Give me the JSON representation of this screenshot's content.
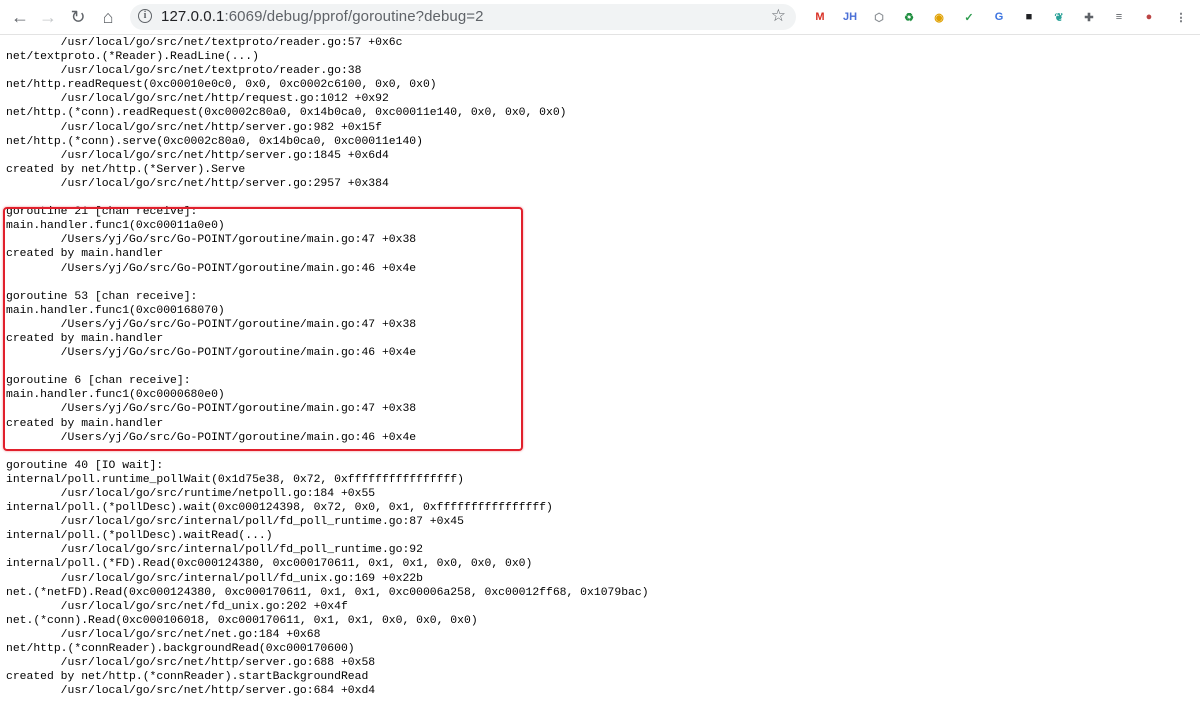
{
  "browser": {
    "url_host": "127.0.0.1",
    "url_rest": ":6069/debug/pprof/goroutine?debug=2",
    "extensions": [
      {
        "name": "gmail-icon",
        "glyph": "M",
        "color": "#d93025"
      },
      {
        "name": "jh-extension-icon",
        "glyph": "JH",
        "color": "#4a6fd6"
      },
      {
        "name": "extension-gray-icon",
        "glyph": "⬡",
        "color": "#8a8f94"
      },
      {
        "name": "extension-green-icon",
        "glyph": "♻",
        "color": "#1e8e3e"
      },
      {
        "name": "chrome-color-icon",
        "glyph": "◉",
        "color": "#e0a000"
      },
      {
        "name": "shield-check-icon",
        "glyph": "✓",
        "color": "#2e9d4f"
      },
      {
        "name": "translate-icon",
        "glyph": "G",
        "color": "#3b73e0"
      },
      {
        "name": "cube-icon",
        "glyph": "■",
        "color": "#202124"
      },
      {
        "name": "leaf-icon",
        "glyph": "❦",
        "color": "#2aa198"
      },
      {
        "name": "puzzle-icon",
        "glyph": "✚",
        "color": "#5f6368"
      },
      {
        "name": "media-list-icon",
        "glyph": "≡",
        "color": "#5f6368"
      },
      {
        "name": "profile-avatar-icon",
        "glyph": "●",
        "color": "#b44"
      },
      {
        "name": "more-menu-icon",
        "glyph": "⋮",
        "color": "#5f6368"
      }
    ]
  },
  "dump": {
    "lines": [
      "        /usr/local/go/src/net/textproto/reader.go:57 +0x6c",
      "net/textproto.(*Reader).ReadLine(...)",
      "        /usr/local/go/src/net/textproto/reader.go:38",
      "net/http.readRequest(0xc00010e0c0, 0x0, 0xc0002c6100, 0x0, 0x0)",
      "        /usr/local/go/src/net/http/request.go:1012 +0x92",
      "net/http.(*conn).readRequest(0xc0002c80a0, 0x14b0ca0, 0xc00011e140, 0x0, 0x0, 0x0)",
      "        /usr/local/go/src/net/http/server.go:982 +0x15f",
      "net/http.(*conn).serve(0xc0002c80a0, 0x14b0ca0, 0xc00011e140)",
      "        /usr/local/go/src/net/http/server.go:1845 +0x6d4",
      "created by net/http.(*Server).Serve",
      "        /usr/local/go/src/net/http/server.go:2957 +0x384",
      "",
      "goroutine 21 [chan receive]:",
      "main.handler.func1(0xc00011a0e0)",
      "        /Users/yj/Go/src/Go-POINT/goroutine/main.go:47 +0x38",
      "created by main.handler",
      "        /Users/yj/Go/src/Go-POINT/goroutine/main.go:46 +0x4e",
      "",
      "goroutine 53 [chan receive]:",
      "main.handler.func1(0xc000168070)",
      "        /Users/yj/Go/src/Go-POINT/goroutine/main.go:47 +0x38",
      "created by main.handler",
      "        /Users/yj/Go/src/Go-POINT/goroutine/main.go:46 +0x4e",
      "",
      "goroutine 6 [chan receive]:",
      "main.handler.func1(0xc0000680e0)",
      "        /Users/yj/Go/src/Go-POINT/goroutine/main.go:47 +0x38",
      "created by main.handler",
      "        /Users/yj/Go/src/Go-POINT/goroutine/main.go:46 +0x4e",
      "",
      "goroutine 40 [IO wait]:",
      "internal/poll.runtime_pollWait(0x1d75e38, 0x72, 0xffffffffffffffff)",
      "        /usr/local/go/src/runtime/netpoll.go:184 +0x55",
      "internal/poll.(*pollDesc).wait(0xc000124398, 0x72, 0x0, 0x1, 0xffffffffffffffff)",
      "        /usr/local/go/src/internal/poll/fd_poll_runtime.go:87 +0x45",
      "internal/poll.(*pollDesc).waitRead(...)",
      "        /usr/local/go/src/internal/poll/fd_poll_runtime.go:92",
      "internal/poll.(*FD).Read(0xc000124380, 0xc000170611, 0x1, 0x1, 0x0, 0x0, 0x0)",
      "        /usr/local/go/src/internal/poll/fd_unix.go:169 +0x22b",
      "net.(*netFD).Read(0xc000124380, 0xc000170611, 0x1, 0x1, 0xc00006a258, 0xc00012ff68, 0x1079bac)",
      "        /usr/local/go/src/net/fd_unix.go:202 +0x4f",
      "net.(*conn).Read(0xc000106018, 0xc000170611, 0x1, 0x1, 0x0, 0x0, 0x0)",
      "        /usr/local/go/src/net/net.go:184 +0x68",
      "net/http.(*connReader).backgroundRead(0xc000170600)",
      "        /usr/local/go/src/net/http/server.go:688 +0x58",
      "created by net/http.(*connReader).startBackgroundRead",
      "        /usr/local/go/src/net/http/server.go:684 +0xd4"
    ]
  }
}
